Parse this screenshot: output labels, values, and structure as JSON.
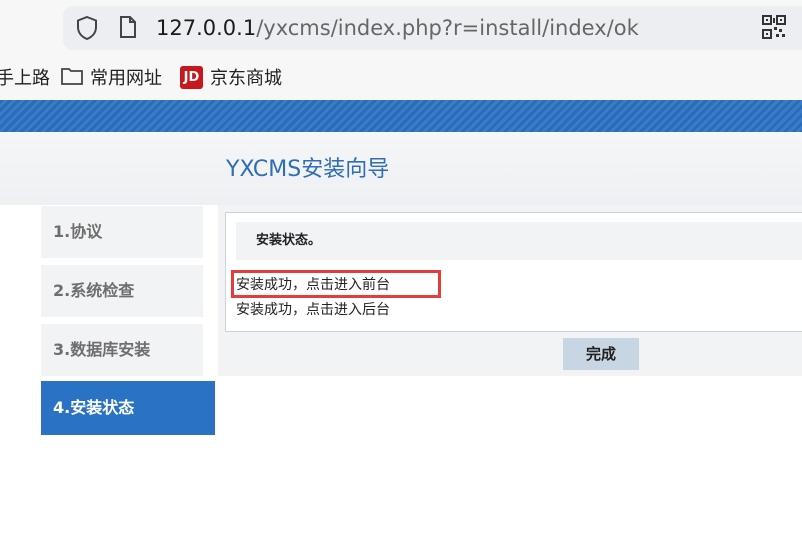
{
  "browser": {
    "url_host": "127.0.0.1",
    "url_path": "/yxcms/index.php?r=install/index/ok",
    "shield_icon": "shield-icon",
    "page_icon": "page-icon",
    "qr_icon": "qr-code-icon"
  },
  "bookmarks": {
    "items": [
      {
        "label": "手上路"
      },
      {
        "label": "常用网址",
        "icon": "folder-icon"
      },
      {
        "label": "京东商城",
        "icon": "jd-logo-icon",
        "badge": "JD"
      }
    ]
  },
  "header": {
    "title": "YXCMS安装向导"
  },
  "steps": [
    {
      "label": "1.协议",
      "active": false
    },
    {
      "label": "2.系统检查",
      "active": false
    },
    {
      "label": "3.数据库安装",
      "active": false
    },
    {
      "label": "4.安装状态",
      "active": true
    }
  ],
  "panel": {
    "heading": "安装状态。",
    "links": [
      {
        "label": "安装成功，点击进入前台",
        "highlighted": true
      },
      {
        "label": "安装成功，点击进入后台",
        "highlighted": false
      }
    ]
  },
  "actions": {
    "done_label": "完成"
  },
  "colors": {
    "accent": "#2a72c4",
    "title": "#2f6db5",
    "highlight": "#e83b3b",
    "button_bg": "#c7d6e2"
  }
}
